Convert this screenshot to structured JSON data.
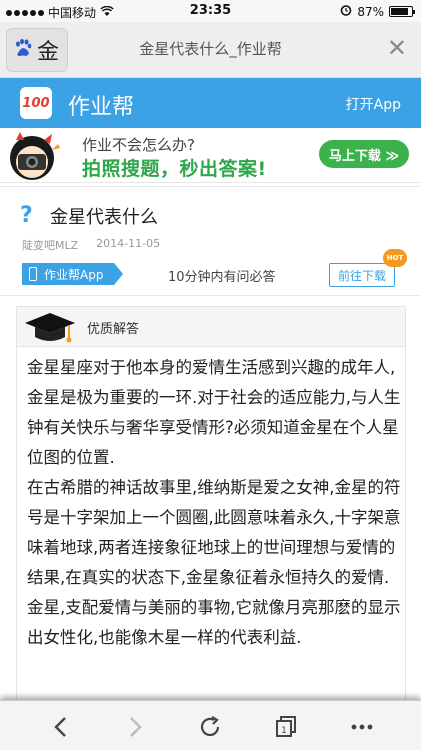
{
  "status_bar": {
    "carrier": "中国移动",
    "time": "23:35",
    "battery": "87%",
    "battery_level": 0.87
  },
  "browser_tab": {
    "tab_text": "金",
    "page_title": "金星代表什么_作业帮",
    "close_symbol": "✕"
  },
  "app_header": {
    "logo_text": "100",
    "app_name": "作业帮",
    "open_app": "打开App",
    "color": "#3ba2e5"
  },
  "banner": {
    "line1": "作业不会怎么办?",
    "line2": "拍照搜题，秒出答案!",
    "button": "马上下载 ≫",
    "accent": "#3cb24c"
  },
  "question": {
    "title": "金星代表什么",
    "user": "陡变吧MLZ",
    "date": "2014-11-05",
    "app_tag": "作业帮App",
    "promise": "10分钟内有问必答",
    "download": "前往下载",
    "hot": "HOT"
  },
  "answer": {
    "label": "优质解答",
    "paragraphs": [
      "金星星座对于他本身的爱情生活感到兴趣的成年人,金星是极为重要的一环.对于社会的适应能力,与人生钟有关快乐与奢华享受情形?必须知道金星在个人星位图的位置.",
      "在古希腊的神话故事里,维纳斯是爱之女神,金星的符号是十字架加上一个圆圈,此圆意味着永久,十字架意味着地球,两者连接象征地球上的世间理想与爱情的结果,在真实的状态下,金星象征着永恒持久的爱情.",
      "金星,支配爱情与美丽的事物,它就像月亮那麽的显示出女性化,也能像木星一样的代表利益."
    ]
  },
  "toolbar": {
    "tab_count": "1"
  }
}
